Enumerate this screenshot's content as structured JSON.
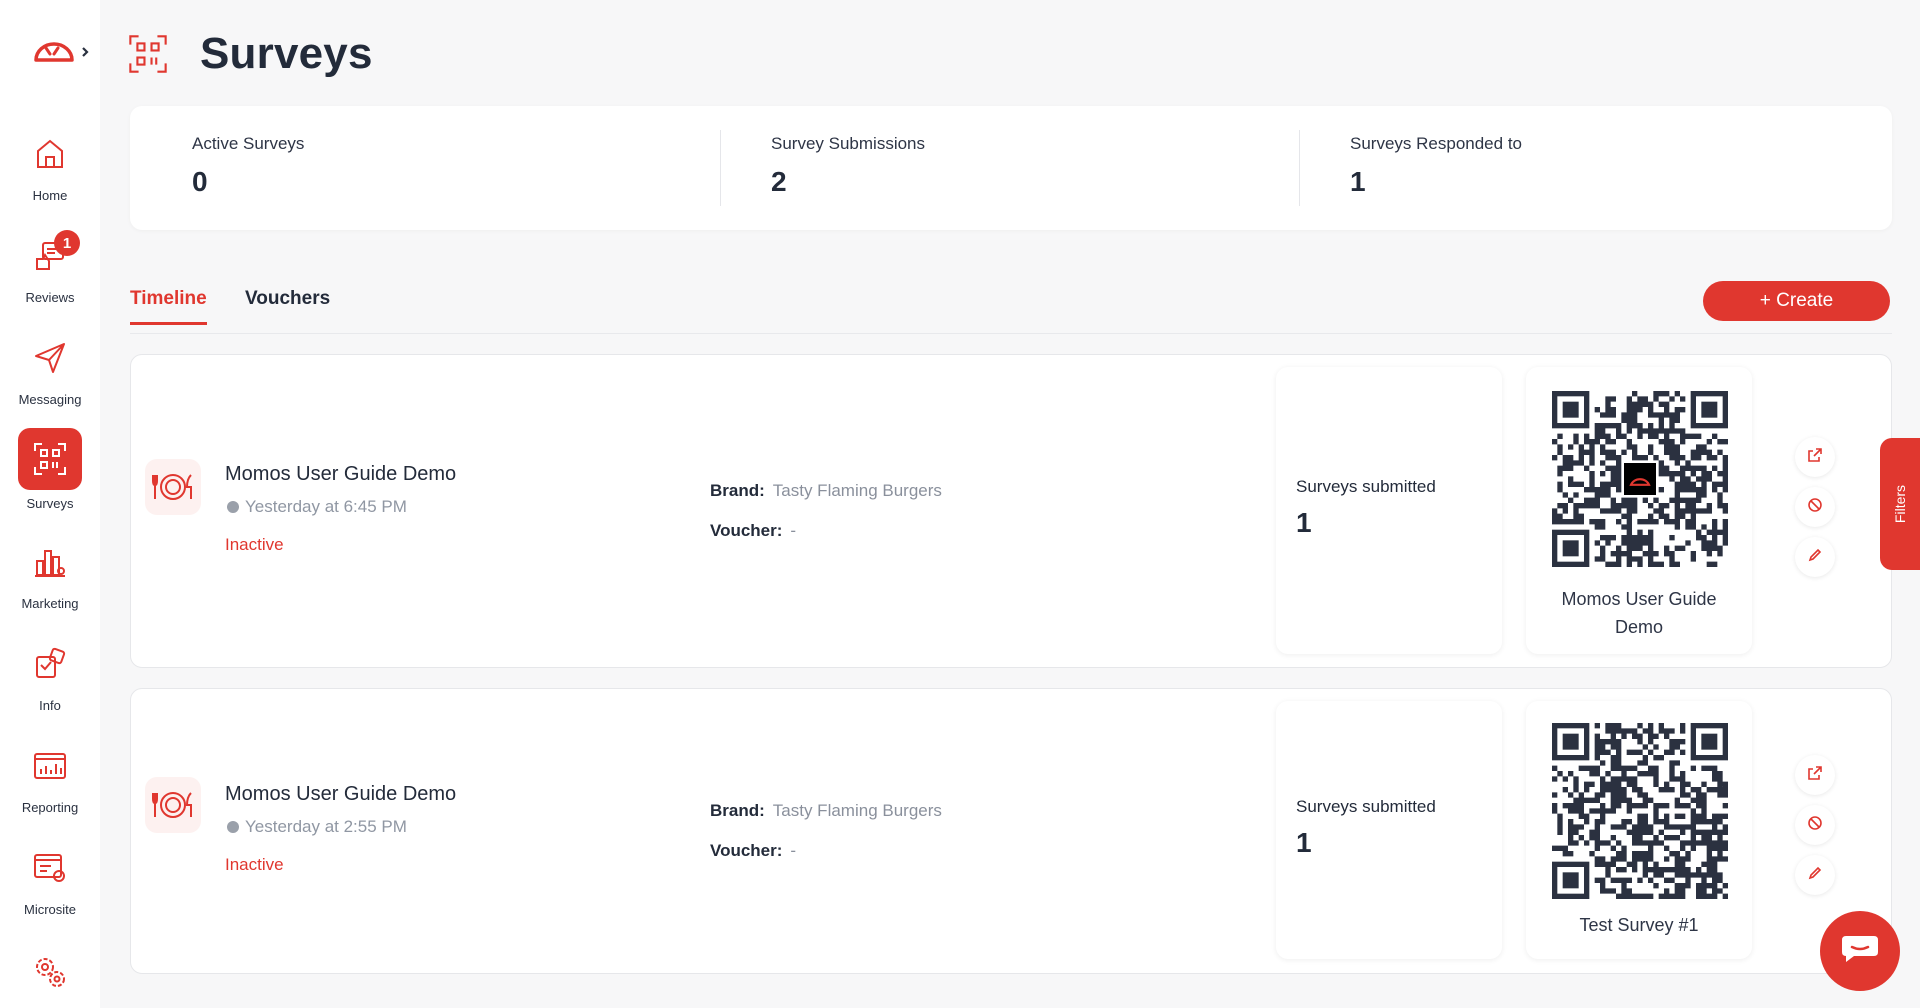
{
  "app": {
    "page_title": "Surveys"
  },
  "sidebar": {
    "items": [
      {
        "label": "Home",
        "icon": "home-icon"
      },
      {
        "label": "Reviews",
        "icon": "reviews-icon",
        "badge": "1"
      },
      {
        "label": "Messaging",
        "icon": "send-icon"
      },
      {
        "label": "Surveys",
        "icon": "qr-scan-icon",
        "active": true
      },
      {
        "label": "Marketing",
        "icon": "marketing-icon"
      },
      {
        "label": "Info",
        "icon": "info-icon"
      },
      {
        "label": "Reporting",
        "icon": "reporting-icon"
      },
      {
        "label": "Microsite",
        "icon": "microsite-icon"
      },
      {
        "label": "",
        "icon": "settings-icon"
      }
    ]
  },
  "stats": [
    {
      "label": "Active Surveys",
      "value": "0"
    },
    {
      "label": "Survey Submissions",
      "value": "2"
    },
    {
      "label": "Surveys Responded to",
      "value": "1"
    }
  ],
  "tabs": [
    {
      "label": "Timeline",
      "active": true
    },
    {
      "label": "Vouchers",
      "active": false
    }
  ],
  "create_button": "+ Create",
  "filters_label": "Filters",
  "cards": [
    {
      "title": "Momos User Guide Demo",
      "time": "Yesterday at 6:45 PM",
      "status": "Inactive",
      "brand_label": "Brand:",
      "brand": "Tasty Flaming Burgers",
      "voucher_label": "Voucher:",
      "voucher": "-",
      "submitted_label": "Surveys submitted",
      "submitted": "1",
      "qr_name": "Momos User Guide Demo"
    },
    {
      "title": "Momos User Guide Demo",
      "time": "Yesterday at 2:55 PM",
      "status": "Inactive",
      "brand_label": "Brand:",
      "brand": "Tasty Flaming Burgers",
      "voucher_label": "Voucher:",
      "voucher": "-",
      "submitted_label": "Surveys submitted",
      "submitted": "1",
      "qr_name": "Test Survey #1"
    }
  ],
  "colors": {
    "accent": "#e0372f",
    "text": "#232b3a",
    "muted": "#8a909c",
    "background": "#f7f7f8"
  }
}
